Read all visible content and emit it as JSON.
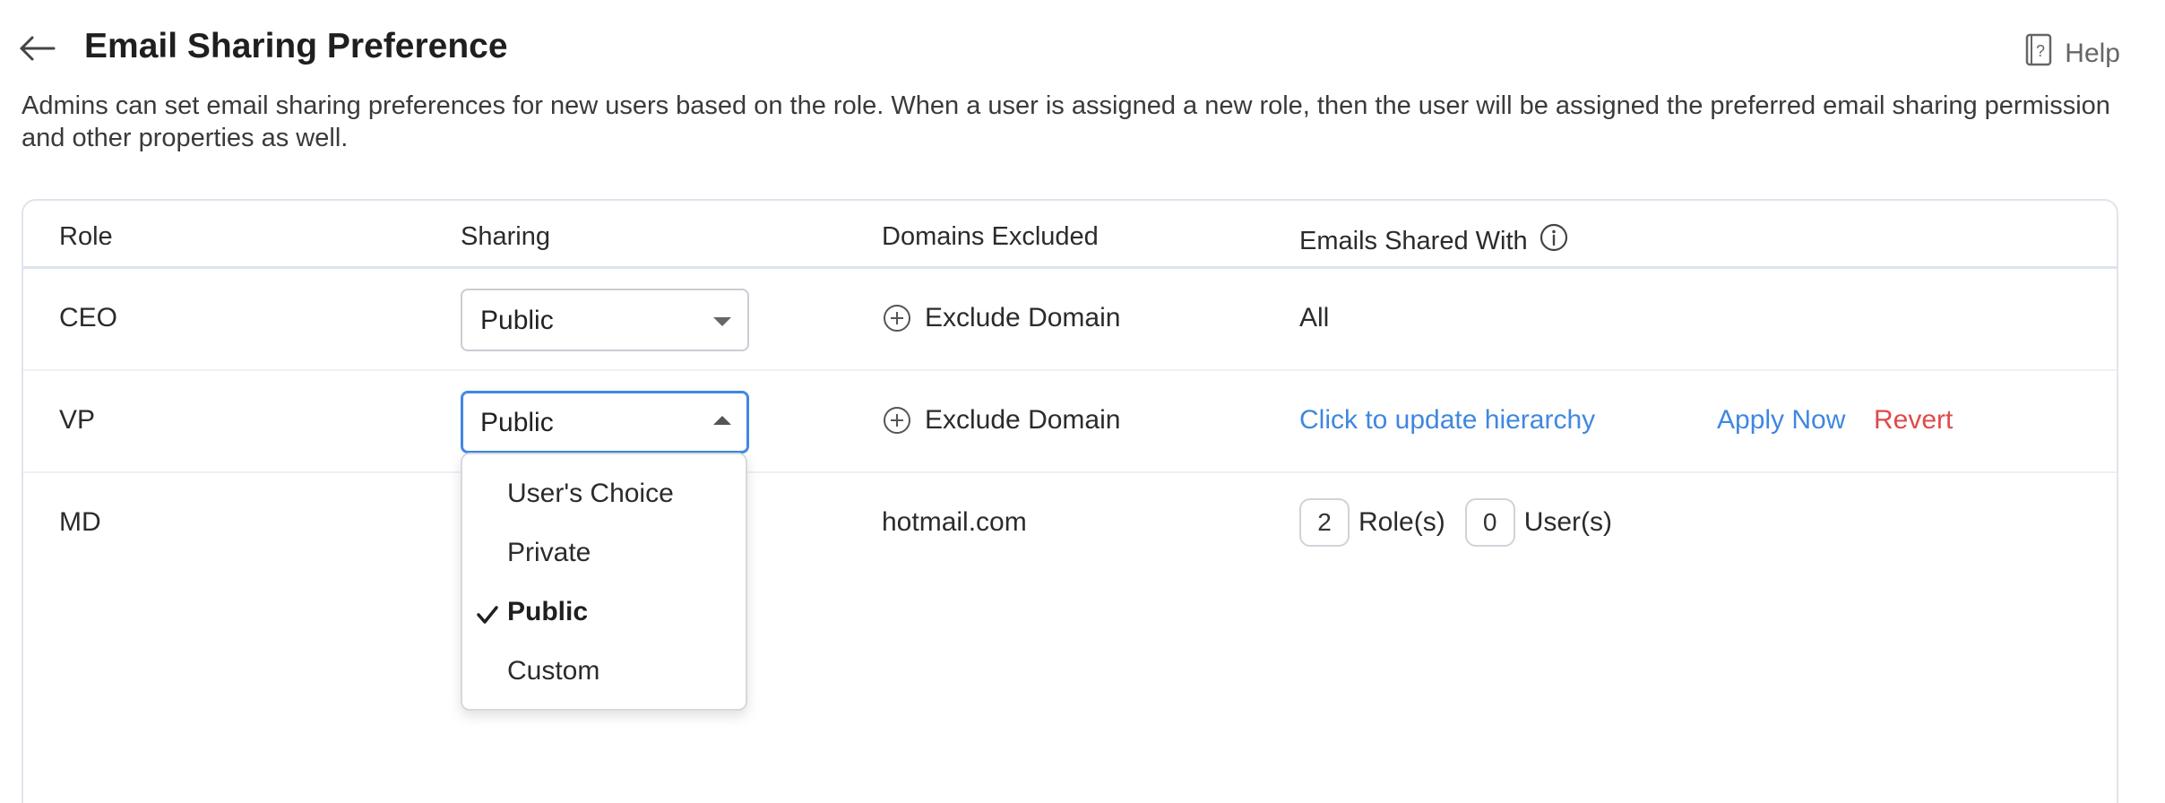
{
  "header": {
    "title": "Email Sharing Preference",
    "help_label": "Help"
  },
  "description": "Admins can set email sharing preferences for new users based on the role. When a user is assigned a new role, then the user will be assigned the preferred email sharing permission and other properties as well.",
  "table": {
    "columns": {
      "role": "Role",
      "sharing": "Sharing",
      "domains_excluded": "Domains Excluded",
      "emails_shared_with": "Emails Shared With"
    },
    "rows": [
      {
        "role": "CEO",
        "sharing": "Public",
        "domains_excluded_action": "Exclude Domain",
        "emails_shared_with": "All"
      },
      {
        "role": "VP",
        "sharing": "Public",
        "domains_excluded_action": "Exclude Domain",
        "emails_shared_with_link": "Click to update hierarchy",
        "apply_now": "Apply Now",
        "revert": "Revert"
      },
      {
        "role": "MD",
        "domains_excluded": "hotmail.com",
        "roles_count": "2",
        "roles_label": "Role(s)",
        "users_count": "0",
        "users_label": "User(s)"
      }
    ]
  },
  "sharing_dropdown": {
    "options": [
      "User's Choice",
      "Private",
      "Public",
      "Custom"
    ],
    "selected": "Public"
  },
  "colors": {
    "accent_blue": "#3f87e0",
    "danger_red": "#e04a4a",
    "header_border": "#dbe4f0"
  }
}
